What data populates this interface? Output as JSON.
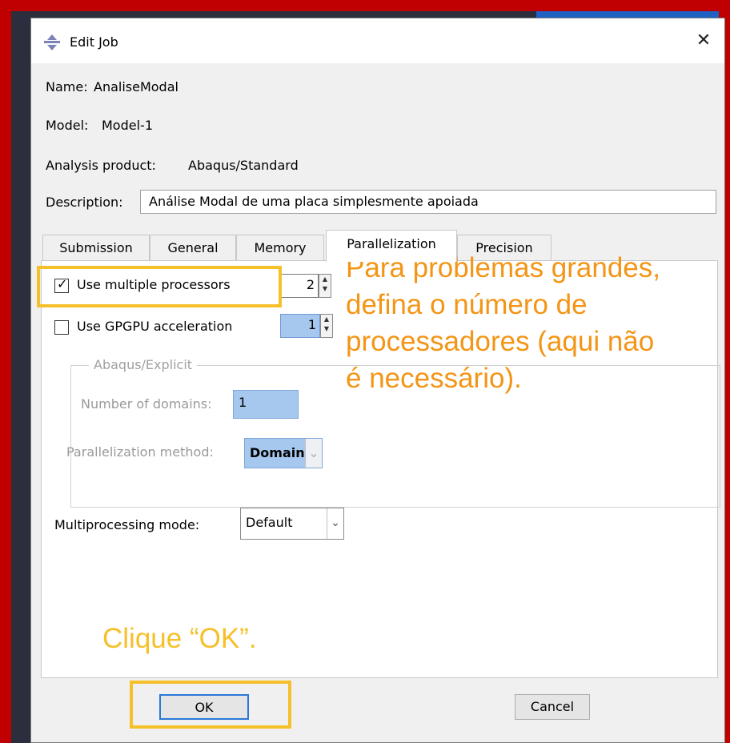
{
  "window": {
    "title": "Edit Job",
    "close_symbol": "✕"
  },
  "info": {
    "name_label": "Name:",
    "name_value": "AnaliseModal",
    "model_label": "Model:",
    "model_value": "Model-1",
    "product_label": "Analysis product:",
    "product_value": "Abaqus/Standard",
    "description_label": "Description:",
    "description_value": "Análise Modal de uma placa simplesmente apoiada"
  },
  "tabs": [
    {
      "label": "Submission",
      "active": false
    },
    {
      "label": "General",
      "active": false
    },
    {
      "label": "Memory",
      "active": false
    },
    {
      "label": "Parallelization",
      "active": true
    },
    {
      "label": "Precision",
      "active": false
    }
  ],
  "parallelization": {
    "multi_proc_label": "Use multiple processors",
    "multi_proc_checked": true,
    "multi_proc_check": "✓",
    "multi_proc_count": "2",
    "gpgpu_label": "Use GPGPU acceleration",
    "gpgpu_checked": false,
    "gpgpu_count": "1",
    "explicit_group_label": "Abaqus/Explicit",
    "domains_label": "Number of domains:",
    "domains_value": "1",
    "method_label": "Parallelization method:",
    "method_value": "Domain",
    "mp_mode_label": "Multiprocessing mode:",
    "mp_mode_value": "Default"
  },
  "buttons": {
    "ok": "OK",
    "cancel": "Cancel"
  },
  "annotations": {
    "main": "Para problemas grandes, defina o número de processadores (aqui não é necessário).",
    "ok": "Clique “OK”."
  },
  "colors": {
    "annotation_main": "#f39516",
    "annotation_ok": "#f6c02a",
    "highlight_box": "#f6c02a",
    "frame": "#c00000"
  }
}
